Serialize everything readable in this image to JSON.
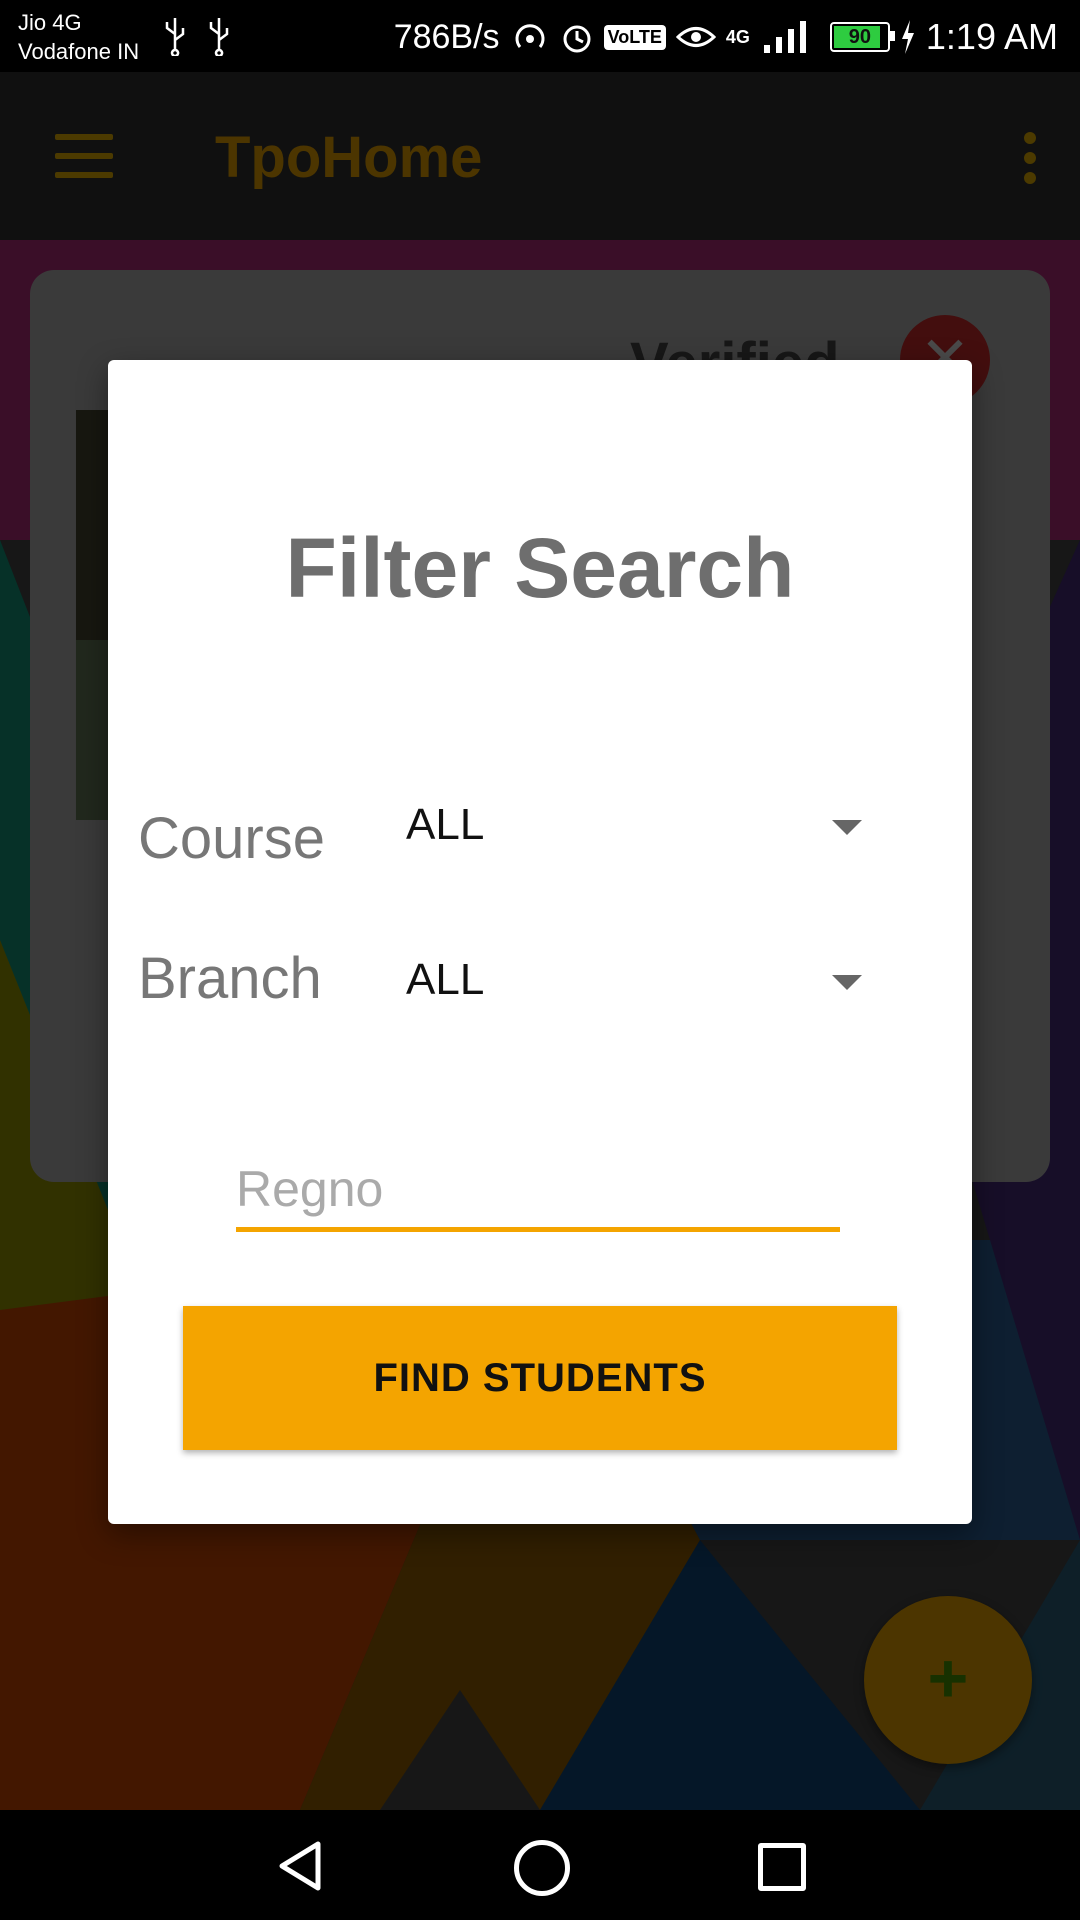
{
  "status_bar": {
    "carrier_line1": "Jio 4G",
    "carrier_line2": "Vodafone IN",
    "speed": "786B/s",
    "volte": "VoLTE",
    "network_type": "4G",
    "battery_level": "90",
    "time": "1:19 AM",
    "icons": [
      "usb-icon",
      "usb-icon",
      "hotspot-icon",
      "alarm-icon",
      "volte-icon",
      "eye-icon",
      "signal-icon",
      "battery-icon",
      "charging-icon"
    ]
  },
  "app_bar": {
    "title": "TpoHome",
    "menu_icon": "hamburger-menu-icon",
    "overflow_icon": "more-vert-icon"
  },
  "background": {
    "card_label": "Verified",
    "close_icon": "close-icon",
    "fab_icon": "plus-icon"
  },
  "dialog": {
    "title": "Filter Search",
    "course_label": "Course",
    "course_value": "ALL",
    "branch_label": "Branch",
    "branch_value": "ALL",
    "regno_placeholder": "Regno",
    "regno_value": "",
    "find_button": "FIND STUDENTS"
  },
  "colors": {
    "accent": "#f4a400",
    "app_bar": "#1e1e1e",
    "title_text": "#6e6e6e"
  }
}
